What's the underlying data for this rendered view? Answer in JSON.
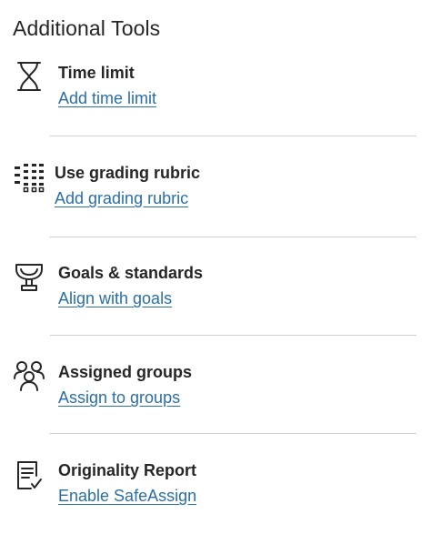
{
  "panel": {
    "title": "Additional Tools"
  },
  "tools": [
    {
      "icon": "hourglass-icon",
      "label": "Time limit",
      "link": "Add time limit"
    },
    {
      "icon": "rubric-grid-icon",
      "label": "Use grading rubric",
      "link": "Add grading rubric"
    },
    {
      "icon": "trophy-icon",
      "label": "Goals & standards",
      "link": "Align with goals"
    },
    {
      "icon": "people-group-icon",
      "label": "Assigned groups",
      "link": "Assign to groups"
    },
    {
      "icon": "report-check-icon",
      "label": "Originality Report",
      "link": "Enable SafeAssign"
    }
  ],
  "colors": {
    "text": "#262626",
    "link": "#2a6fa8",
    "divider": "#cfcfcf",
    "background": "#ffffff"
  }
}
